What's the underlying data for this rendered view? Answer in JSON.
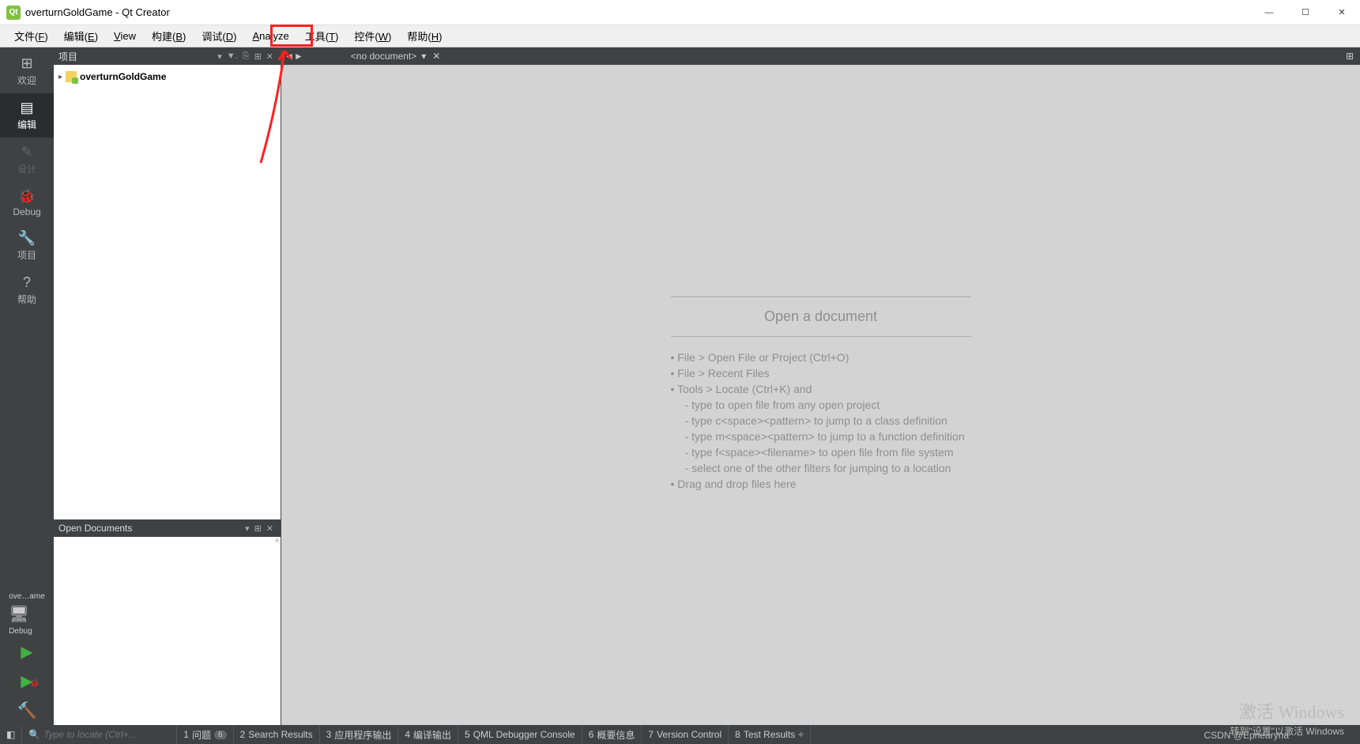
{
  "window": {
    "title": "overturnGoldGame - Qt Creator",
    "logo_letter": "Qt"
  },
  "menubar": [
    {
      "label": "文件",
      "accel": "F"
    },
    {
      "label": "编辑",
      "accel": "E"
    },
    {
      "label": "View",
      "accel": ""
    },
    {
      "label": "构建",
      "accel": "B"
    },
    {
      "label": "调试",
      "accel": "D"
    },
    {
      "label": "Analyze",
      "accel": ""
    },
    {
      "label": "工具",
      "accel": "T"
    },
    {
      "label": "控件",
      "accel": "W"
    },
    {
      "label": "帮助",
      "accel": "H"
    }
  ],
  "leftbar": {
    "items": [
      {
        "icon": "⊞",
        "label": "欢迎"
      },
      {
        "icon": "▤",
        "label": "编辑"
      },
      {
        "icon": "✎",
        "label": "设计"
      },
      {
        "icon": "🐞",
        "label": "Debug"
      },
      {
        "icon": "🔧",
        "label": "项目"
      },
      {
        "icon": "?",
        "label": "帮助"
      }
    ],
    "target": "ove…ame",
    "mode": "Debug",
    "run": "▶",
    "rundbg": "▶",
    "build": "🔨"
  },
  "projects_panel": {
    "title": "项目",
    "root": "overturnGoldGame"
  },
  "opendocs_panel": {
    "title": "Open Documents"
  },
  "editor": {
    "doc": "<no document>",
    "placeholder": {
      "title": "Open a document",
      "lines": [
        "File > Open File or Project (Ctrl+O)",
        "File > Recent Files",
        "Tools > Locate (Ctrl+K) and"
      ],
      "sublines": [
        "type to open file from any open project",
        "type c<space><pattern> to jump to a class definition",
        "type m<space><pattern> to jump to a function definition",
        "type f<space><filename> to open file from file system",
        "select one of the other filters for jumping to a location"
      ],
      "last": "Drag and drop files here"
    }
  },
  "statusbar": {
    "locate_placeholder": "Type to locate (Ctrl+...",
    "items": [
      {
        "n": "1",
        "label": "问题",
        "badge": "6"
      },
      {
        "n": "2",
        "label": "Search Results"
      },
      {
        "n": "3",
        "label": "应用程序输出"
      },
      {
        "n": "4",
        "label": "编译输出"
      },
      {
        "n": "5",
        "label": "QML Debugger Console"
      },
      {
        "n": "6",
        "label": "概要信息"
      },
      {
        "n": "7",
        "label": "Version Control"
      },
      {
        "n": "8",
        "label": "Test Results"
      }
    ]
  },
  "watermark": "激活 Windows",
  "watermark2": "转到\"设置\"以激活 Windows",
  "csdn": "CSDN @Epnearyna"
}
